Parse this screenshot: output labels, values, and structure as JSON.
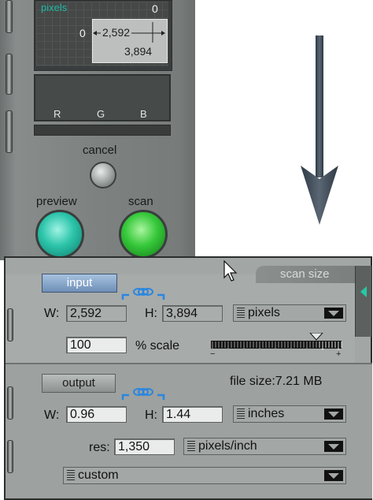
{
  "dimensions_panel": {
    "unit_label": "pixels",
    "corner_top": "0",
    "corner_left": "0",
    "width_value": "2,592",
    "height_value": "3,894"
  },
  "channels": [
    "R",
    "G",
    "B"
  ],
  "buttons": {
    "cancel": "cancel",
    "preview": "preview",
    "scan": "scan"
  },
  "scan_size": {
    "tab_label": "scan size",
    "input": {
      "button_label": "input",
      "width_label": "W:",
      "width_value": "2,592",
      "height_label": "H:",
      "height_value": "3,894",
      "unit": "pixels",
      "scale_value": "100",
      "scale_label": "% scale",
      "slider_minus": "−",
      "slider_plus": "+"
    },
    "output": {
      "button_label": "output",
      "file_size": "file size:7.21 MB",
      "width_label": "W:",
      "width_value": "0.96",
      "height_label": "H:",
      "height_value": "1.44",
      "unit": "inches",
      "res_label": "res:",
      "res_value": "1,350",
      "res_unit": "pixels/inch",
      "preset": "custom"
    }
  },
  "colors": {
    "panel": "#7d8281",
    "preview_button": "#2cc4aa",
    "scan_button": "#36c83a",
    "input_button": "#7e9ec4",
    "unit_label": "#1fb8a5",
    "arrow": "#3e4a57"
  }
}
